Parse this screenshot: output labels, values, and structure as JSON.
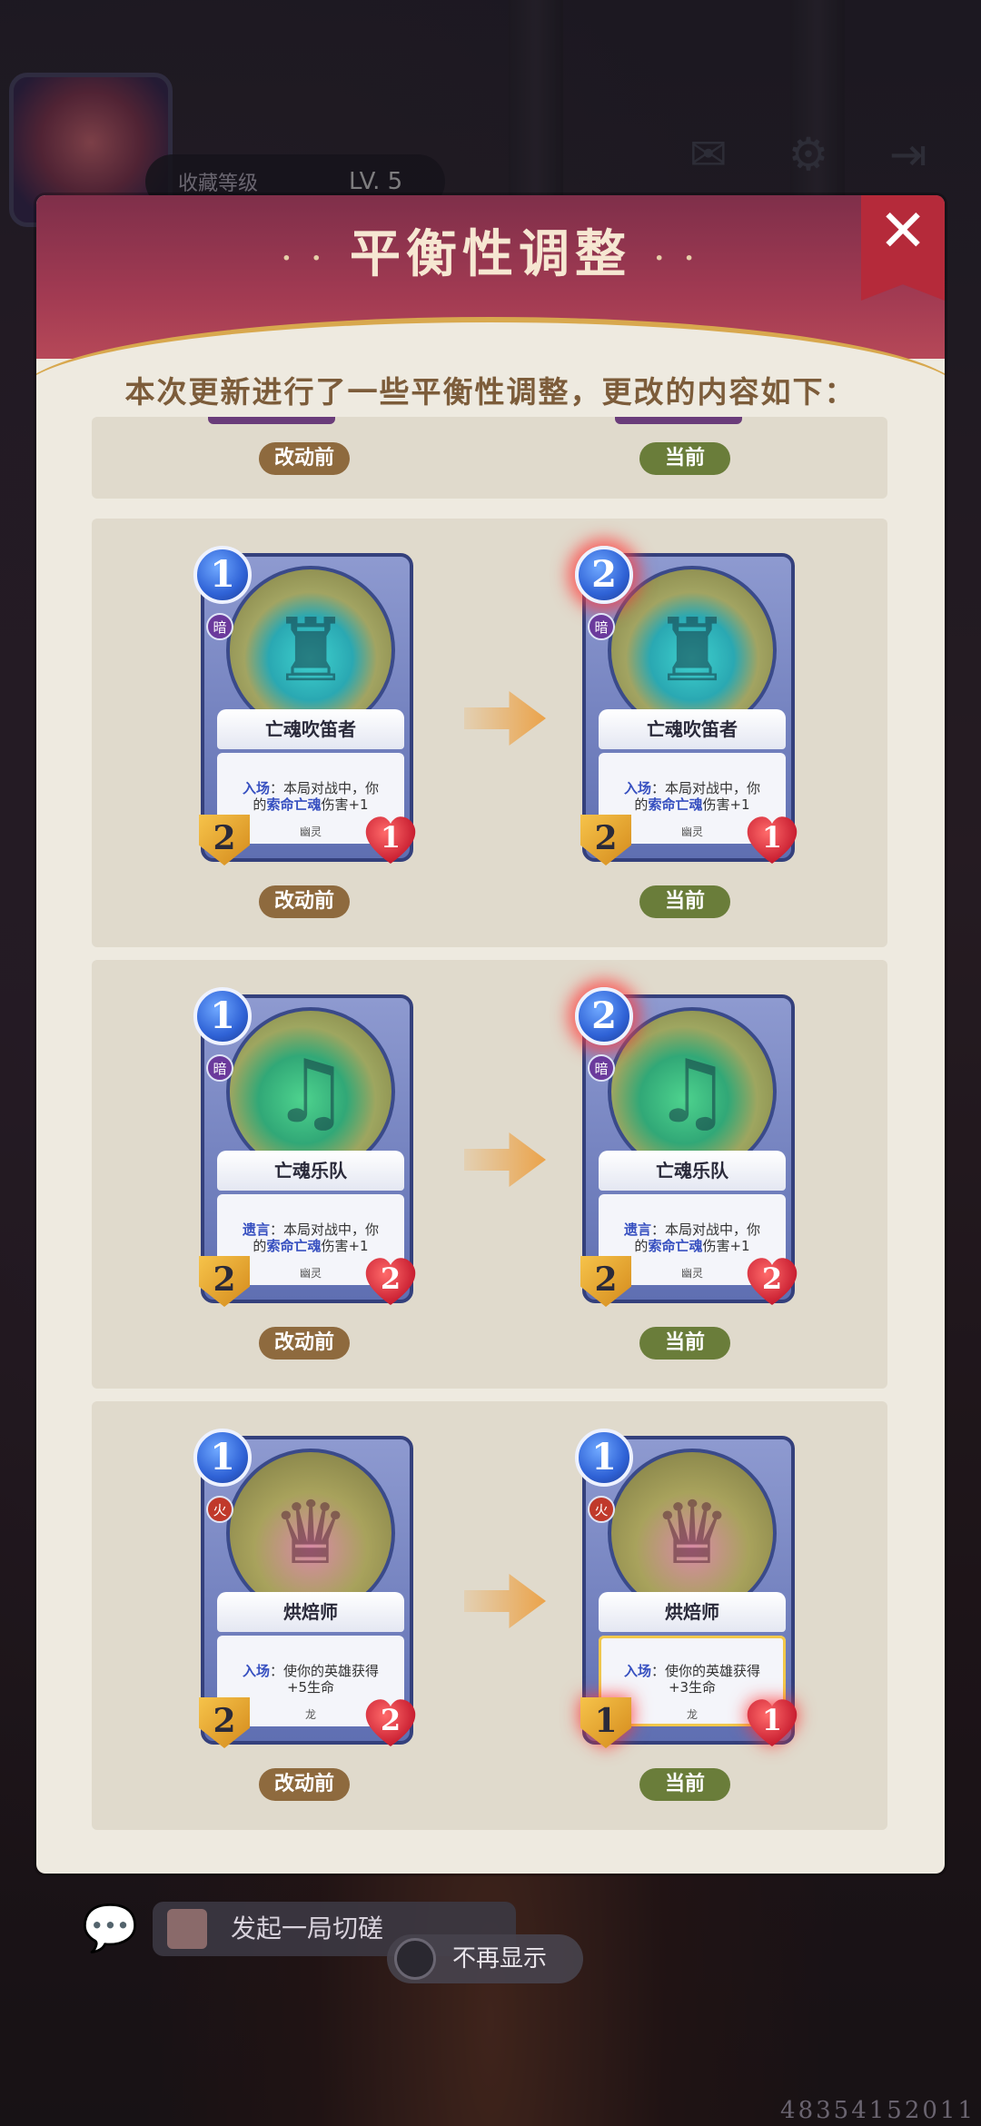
{
  "header": {
    "collection_label": "收藏等级",
    "collection_level": "LV. 5"
  },
  "modal": {
    "title": "平衡性调整",
    "title_dots_left": "· ·",
    "title_dots_right": "· ·",
    "subtitle": "本次更新进行了一些平衡性调整，更改的内容如下：",
    "tag_before": "改动前",
    "tag_after": "当前"
  },
  "changes": [
    {
      "before": {
        "name": "亡魂吹笛者",
        "cost": "1",
        "element": "暗",
        "text_kw": "入场",
        "text_line1": "：本局对战中，你",
        "text_pre": "的",
        "text_kw2": "索命亡魂",
        "text_post": "伤害+1",
        "tribe": "幽灵",
        "attack": "2",
        "health": "1"
      },
      "after": {
        "name": "亡魂吹笛者",
        "cost": "2",
        "element": "暗",
        "text_kw": "入场",
        "text_line1": "：本局对战中，你",
        "text_pre": "的",
        "text_kw2": "索命亡魂",
        "text_post": "伤害+1",
        "tribe": "幽灵",
        "attack": "2",
        "health": "1"
      }
    },
    {
      "before": {
        "name": "亡魂乐队",
        "cost": "1",
        "element": "暗",
        "text_kw": "遗言",
        "text_line1": "：本局对战中，你",
        "text_pre": "的",
        "text_kw2": "索命亡魂",
        "text_post": "伤害+1",
        "tribe": "幽灵",
        "attack": "2",
        "health": "2"
      },
      "after": {
        "name": "亡魂乐队",
        "cost": "2",
        "element": "暗",
        "text_kw": "遗言",
        "text_line1": "：本局对战中，你",
        "text_pre": "的",
        "text_kw2": "索命亡魂",
        "text_post": "伤害+1",
        "tribe": "幽灵",
        "attack": "2",
        "health": "2"
      }
    },
    {
      "before": {
        "name": "烘焙师",
        "cost": "1",
        "element": "火",
        "text_kw": "入场",
        "text_line1": "：使你的英雄获得",
        "text_line2": "+5生命",
        "tribe": "龙",
        "attack": "2",
        "health": "2"
      },
      "after": {
        "name": "烘焙师",
        "cost": "1",
        "element": "火",
        "text_kw": "入场",
        "text_line1": "：使你的英雄获得",
        "text_line2": "+3生命",
        "tribe": "龙",
        "attack": "1",
        "health": "1"
      }
    }
  ],
  "footer": {
    "challenge_label": "发起一局切磋",
    "dont_show_label": "不再显示",
    "user_id": "48354152011"
  },
  "icons": {
    "close": "close-icon",
    "arrow": "arrow-right-icon",
    "mail": "mail-icon",
    "settings": "gear-icon",
    "exit": "exit-icon",
    "chat": "chat-icon"
  }
}
